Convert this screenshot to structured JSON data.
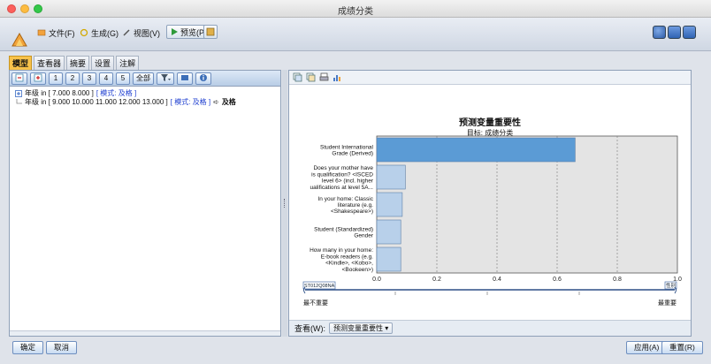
{
  "window": {
    "title": "成绩分类"
  },
  "menu": {
    "file": "文件(F)",
    "generate": "生成(G)",
    "view": "视图(V)",
    "preview": "预览(P)"
  },
  "tabs": [
    "模型",
    "查看器",
    "摘要",
    "设置",
    "注解"
  ],
  "left_toolbar": {
    "levels": [
      "1",
      "2",
      "3",
      "4",
      "5"
    ],
    "all": "全部"
  },
  "tree": {
    "rule1": {
      "text": "年级 in [ 7.000 8.000 ]",
      "mode": "[ 模式: 及格 ]"
    },
    "rule2": {
      "text": "年级 in [ 9.000 10.000 11.000 12.000 13.000 ]",
      "mode": "[ 模式: 及格 ]",
      "arrow": "➪",
      "result": "及格"
    }
  },
  "viewbar": {
    "label": "查看(W):",
    "selected": "预测变量重要性"
  },
  "slider": {
    "left_box": "ST012Q08NA",
    "right_box": "性别",
    "left_label": "最不重要",
    "right_label": "最重要"
  },
  "buttons": {
    "ok": "确定",
    "cancel": "取消",
    "apply": "应用(A)",
    "reset": "重置(R)"
  },
  "colors": {
    "bar_top": "#5b9bd5",
    "bar_other": "#b8d0ea",
    "accent_tab": "#f8c24a"
  },
  "chart_data": {
    "type": "bar",
    "orientation": "horizontal",
    "title": "预测变量重要性",
    "subtitle": "目标:  成绩分类",
    "categories": [
      [
        "Student International",
        "Grade (Derived)"
      ],
      [
        "Does your mother have",
        "is qualification? <ISCED",
        "level 6> (incl. higher",
        "ualifications at level 5A..."
      ],
      [
        "In your home: Classic",
        "literature (e.g.",
        "<Shakespeare>)"
      ],
      [
        "Student (Standardized)",
        "Gender"
      ],
      [
        "How many in your home:",
        "E-book readers (e.g.",
        "<Kindle>, <Kobo>,",
        "<Bookeen>)"
      ]
    ],
    "values": [
      0.66,
      0.095,
      0.085,
      0.08,
      0.08
    ],
    "xlim": [
      0,
      1
    ],
    "xticks": [
      "0.0",
      "0.2",
      "0.4",
      "0.6",
      "0.8",
      "1.0"
    ],
    "grid": true
  }
}
